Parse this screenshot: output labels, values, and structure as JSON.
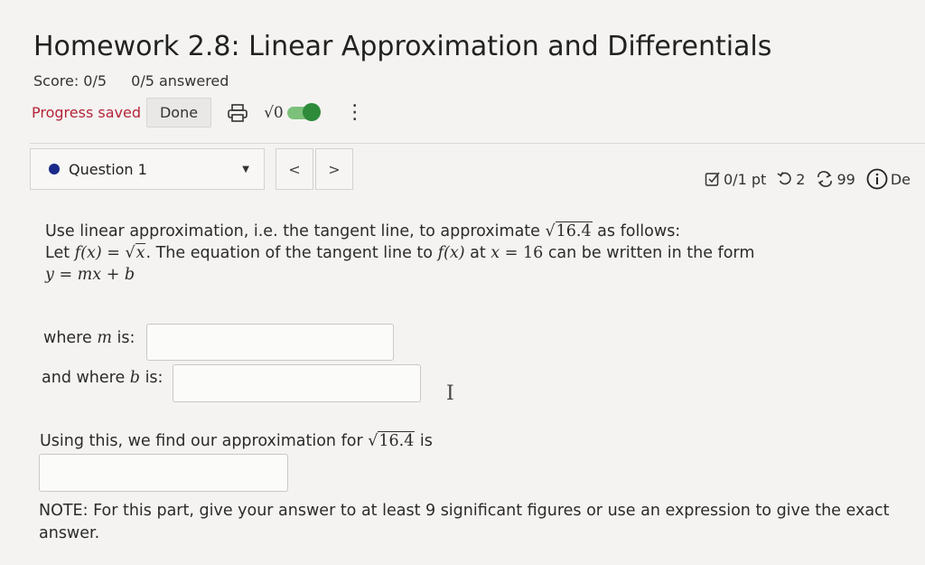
{
  "header": {
    "title": "Homework 2.8: Linear Approximation and Differentials",
    "score": "Score: 0/5",
    "answered": "0/5 answered",
    "progress_saved": "Progress saved",
    "done_label": "Done",
    "sqrt_toggle_label": "√0"
  },
  "question_bar": {
    "label": "Question 1",
    "prev": "<",
    "next": ">"
  },
  "meta": {
    "points": "0/1 pt",
    "retries": "2",
    "attempts": "99",
    "details": "De"
  },
  "question": {
    "intro_a": "Use linear approximation, i.e. the tangent line, to approximate ",
    "radicand": "16.4",
    "intro_b": " as follows:",
    "let_a": "Let ",
    "fx": "f(x)",
    "eq": " = ",
    "sqrt_x": "x",
    "let_b": ". The equation of the tangent line to ",
    "fx2": "f(x)",
    "at": " at ",
    "x": "x",
    "eq2": " = ",
    "x_val": "16",
    "let_c": " can be written in the form",
    "form": "y = mx + b",
    "m_label_a": "where ",
    "m_var": "m",
    "m_label_b": " is:",
    "b_label_a": "and where ",
    "b_var": "b",
    "b_label_b": " is:",
    "approx_a": "Using this, we find our approximation for ",
    "approx_rad": "16.4",
    "approx_b": " is",
    "note": "NOTE: For this part, give your answer to at least 9 significant figures or use an expression to give the exact answer."
  },
  "colors": {
    "accent_red": "#b5243a",
    "toggle_green": "#2e8b3a",
    "question_dot": "#1a2a8a"
  }
}
